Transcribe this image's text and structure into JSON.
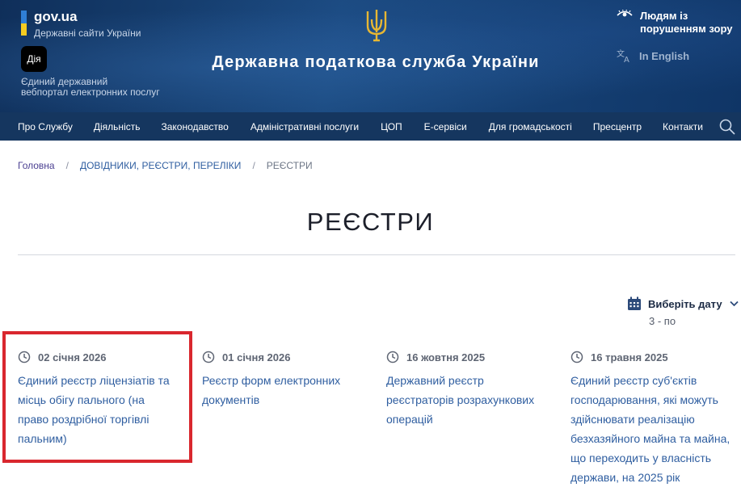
{
  "header": {
    "govua_title": "gov.ua",
    "govua_sub": "Державні сайти України",
    "diia_label": "Дія",
    "portal_line1": "Єдиний державний",
    "portal_line2": "вебпортал електронних послуг",
    "site_title": "Державна податкова служба України",
    "accessibility_line1": "Людям із",
    "accessibility_line2": "порушенням зору",
    "language": "In English",
    "colors": {
      "flag_blue": "#2f7fd6",
      "flag_yellow": "#f5cc21",
      "trident": "#e7b733"
    }
  },
  "nav": {
    "items": [
      "Про Службу",
      "Діяльність",
      "Законодавство",
      "Адміністративні послуги",
      "ЦОП",
      "Е-сервіси",
      "Для громадськості",
      "Пресцентр",
      "Контакти"
    ],
    "search_icon": "search-icon"
  },
  "breadcrumbs": [
    "Головна",
    "ДОВІДНИКИ, РЕЄСТРИ, ПЕРЕЛІКИ",
    "РЕЄСТРИ"
  ],
  "page_title": "РЕЄСТРИ",
  "date_filter": {
    "label": "Виберіть дату",
    "range": "3 - по"
  },
  "cards": [
    {
      "date": "02 січня 2026",
      "lines": [
        "Єдиний реєстр ліцензіатів та",
        "місць обігу пального (на",
        "право роздрібної торгівлі",
        "пальним)"
      ]
    },
    {
      "date": "01 січня 2026",
      "lines": [
        "Реєстр форм електронних",
        "документів"
      ]
    },
    {
      "date": "16 жовтня 2025",
      "lines": [
        "Державний реєстр",
        "реєстраторів розрахункових",
        "операцій"
      ]
    },
    {
      "date": "16 травня 2025",
      "lines": [
        "Єдиний реєстр суб'єктів",
        "господарювання, які можуть",
        "здійснювати реалізацію",
        "безхазяйного майна та майна,",
        "що переходить у власність",
        "держави, на 2025 рік"
      ]
    }
  ]
}
